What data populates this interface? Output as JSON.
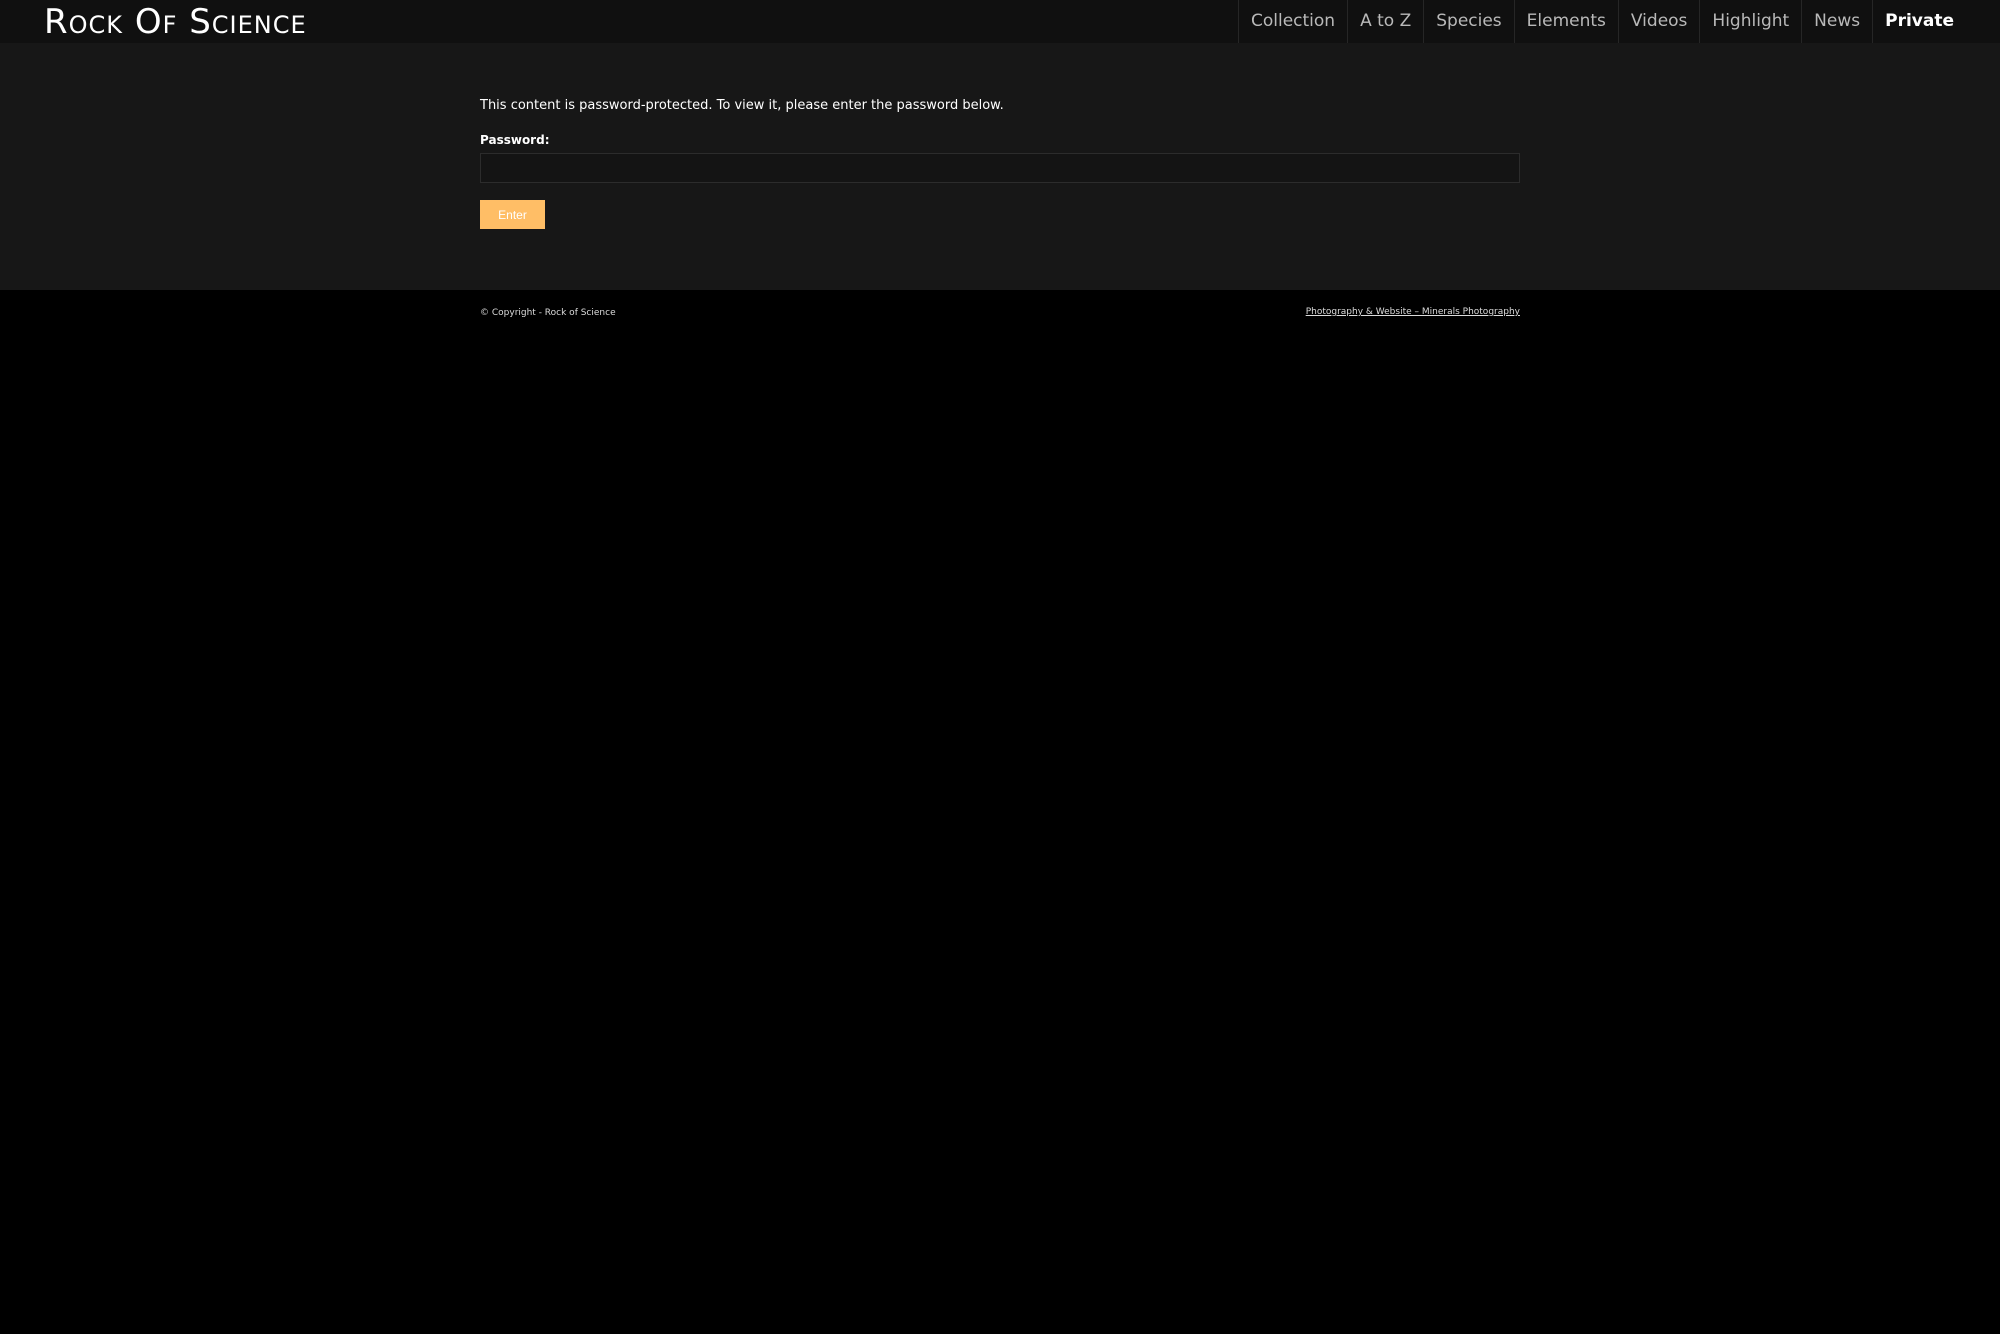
{
  "header": {
    "logo_text": "Rock Of Science",
    "nav": [
      {
        "label": "Collection"
      },
      {
        "label": "A to Z"
      },
      {
        "label": "Species"
      },
      {
        "label": "Elements"
      },
      {
        "label": "Videos"
      },
      {
        "label": "Highlight"
      },
      {
        "label": "News"
      },
      {
        "label": "Private"
      }
    ],
    "active_nav": "Private"
  },
  "main": {
    "notice": "This content is password-protected. To view it, please enter the password below.",
    "password_label": "Password:",
    "password_value": "",
    "enter_label": "Enter"
  },
  "footer": {
    "copyright": "© Copyright - Rock of Science",
    "credit": "Photography & Website – Minerals Photography"
  },
  "colors": {
    "header_bg": "#101010",
    "main_bg": "#171717",
    "page_bg": "#000000",
    "button_bg": "#ffbe66",
    "text": "#ffffff"
  }
}
